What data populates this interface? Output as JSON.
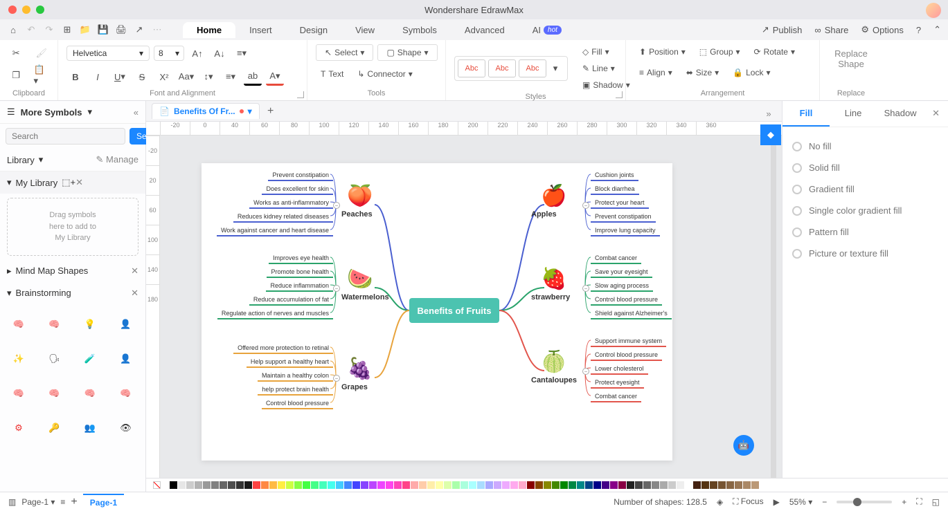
{
  "app_title": "Wondershare EdrawMax",
  "menubar": [
    "Home",
    "Insert",
    "Design",
    "View",
    "Symbols",
    "Advanced",
    "AI"
  ],
  "active_tab": "Home",
  "topright": {
    "publish": "Publish",
    "share": "Share",
    "options": "Options"
  },
  "ribbon": {
    "clipboard_label": "Clipboard",
    "font_label": "Font and Alignment",
    "tools_label": "Tools",
    "styles_label": "Styles",
    "arrangement_label": "Arrangement",
    "replace_label": "Replace",
    "font_name": "Helvetica",
    "font_size": "8",
    "select": "Select",
    "shape": "Shape",
    "text": "Text",
    "connector": "Connector",
    "style_sample": "Abc",
    "fill": "Fill",
    "line": "Line",
    "shadow": "Shadow",
    "position": "Position",
    "group": "Group",
    "rotate": "Rotate",
    "align": "Align",
    "size": "Size",
    "lock": "Lock",
    "replace_shape": "Replace\nShape"
  },
  "left": {
    "more_symbols": "More Symbols",
    "search_placeholder": "Search",
    "search_btn": "Search",
    "library": "Library",
    "manage": "Manage",
    "mylib": "My Library",
    "mylib_drop": "Drag symbols\nhere to add to\nMy Library",
    "mindmap": "Mind Map Shapes",
    "brainstorm": "Brainstorming"
  },
  "doc": {
    "tab_name": "Benefits Of Fr...",
    "ruler_h": [
      "-20",
      "0",
      "40",
      "60",
      "80",
      "100",
      "120",
      "140",
      "160",
      "180",
      "200",
      "220",
      "240",
      "260",
      "280",
      "300",
      "320",
      "340",
      "360"
    ],
    "ruler_v": [
      "-20",
      "20",
      "60",
      "100",
      "140",
      "180"
    ]
  },
  "mindmap": {
    "center": "Benefits of Fruits",
    "left_branches": [
      {
        "name": "Peaches",
        "emoji": "🍑",
        "color": "#4a5fd0",
        "items": [
          "Prevent constipation",
          "Does excellent for skin",
          "Works as anti-inflammatory",
          "Reduces kidney related diseases",
          "Work against cancer and heart disease"
        ]
      },
      {
        "name": "Watermelons",
        "emoji": "🍉",
        "color": "#2aa36b",
        "items": [
          "Improves eye health",
          "Promote bone health",
          "Reduce inflammation",
          "Reduce accumulation of fat",
          "Regulate action of nerves and muscles"
        ]
      },
      {
        "name": "Grapes",
        "emoji": "🍇",
        "color": "#e8a33c",
        "items": [
          "Offered more protection to retinal",
          "Help support a healthy heart",
          "Maintain a healthy colon",
          "help protect brain health",
          "Control blood pressure"
        ]
      }
    ],
    "right_branches": [
      {
        "name": "Apples",
        "emoji": "🍎",
        "color": "#4a5fd0",
        "items": [
          "Cushion joints",
          "Block diarrhea",
          "Protect your heart",
          "Prevent constipation",
          "Improve lung capacity"
        ]
      },
      {
        "name": "strawberry",
        "emoji": "🍓",
        "color": "#2aa36b",
        "items": [
          "Combat cancer",
          "Save your eyesight",
          "Slow aging process",
          "Control blood pressure",
          "Shield against Alzheimer's"
        ]
      },
      {
        "name": "Cantaloupes",
        "emoji": "🍈",
        "color": "#e2554c",
        "items": [
          "Support immune system",
          "Control blood pressure",
          "Lower cholesterol",
          "Protect eyesight",
          "Combat cancer"
        ]
      }
    ]
  },
  "right_panel": {
    "tabs": [
      "Fill",
      "Line",
      "Shadow"
    ],
    "options": [
      "No fill",
      "Solid fill",
      "Gradient fill",
      "Single color gradient fill",
      "Pattern fill",
      "Picture or texture fill"
    ]
  },
  "status": {
    "page_label": "Page-1",
    "page_tab": "Page-1",
    "shapes": "Number of shapes: 128.5",
    "focus": "Focus",
    "zoom": "55%"
  }
}
